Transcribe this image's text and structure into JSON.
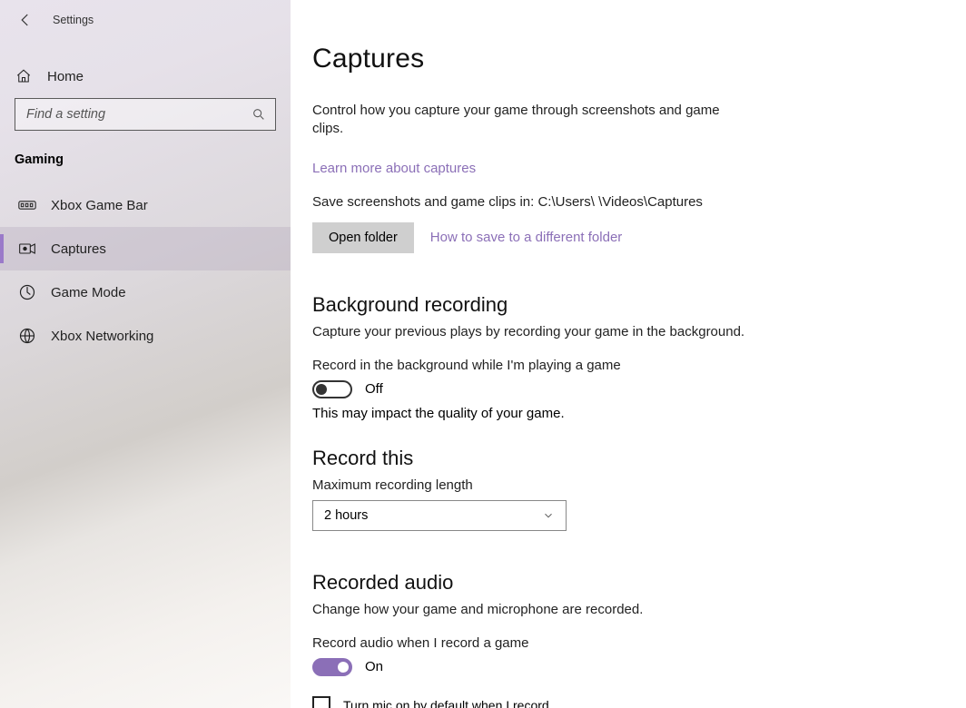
{
  "appTitle": "Settings",
  "search": {
    "placeholder": "Find a setting"
  },
  "home": {
    "label": "Home"
  },
  "sectionLabel": "Gaming",
  "nav": {
    "items": [
      {
        "label": "Xbox Game Bar",
        "selected": false,
        "icon": "gamebar"
      },
      {
        "label": "Captures",
        "selected": true,
        "icon": "captures"
      },
      {
        "label": "Game Mode",
        "selected": false,
        "icon": "gamemode"
      },
      {
        "label": "Xbox Networking",
        "selected": false,
        "icon": "network"
      }
    ]
  },
  "page": {
    "title": "Captures",
    "desc": "Control how you capture your game through screenshots and game clips.",
    "learnMore": "Learn more about captures",
    "savePath": "Save screenshots and game clips in: C:\\Users\\        \\Videos\\Captures",
    "openFolder": "Open folder",
    "howTo": "How to save to a different folder",
    "bg": {
      "title": "Background recording",
      "desc": "Capture your previous plays by recording your game in the background.",
      "toggleLabel": "Record in the background while I'm playing a game",
      "toggleState": "Off",
      "toggleOn": false,
      "note": "This may impact the quality of your game."
    },
    "recordThis": {
      "title": "Record this",
      "label": "Maximum recording length",
      "value": "2 hours"
    },
    "audio": {
      "title": "Recorded audio",
      "desc": "Change how your game and microphone are recorded.",
      "toggleLabel": "Record audio when I record a game",
      "toggleState": "On",
      "toggleOn": true,
      "micCheckbox": "Turn mic on by default when I record",
      "micChecked": false
    }
  }
}
